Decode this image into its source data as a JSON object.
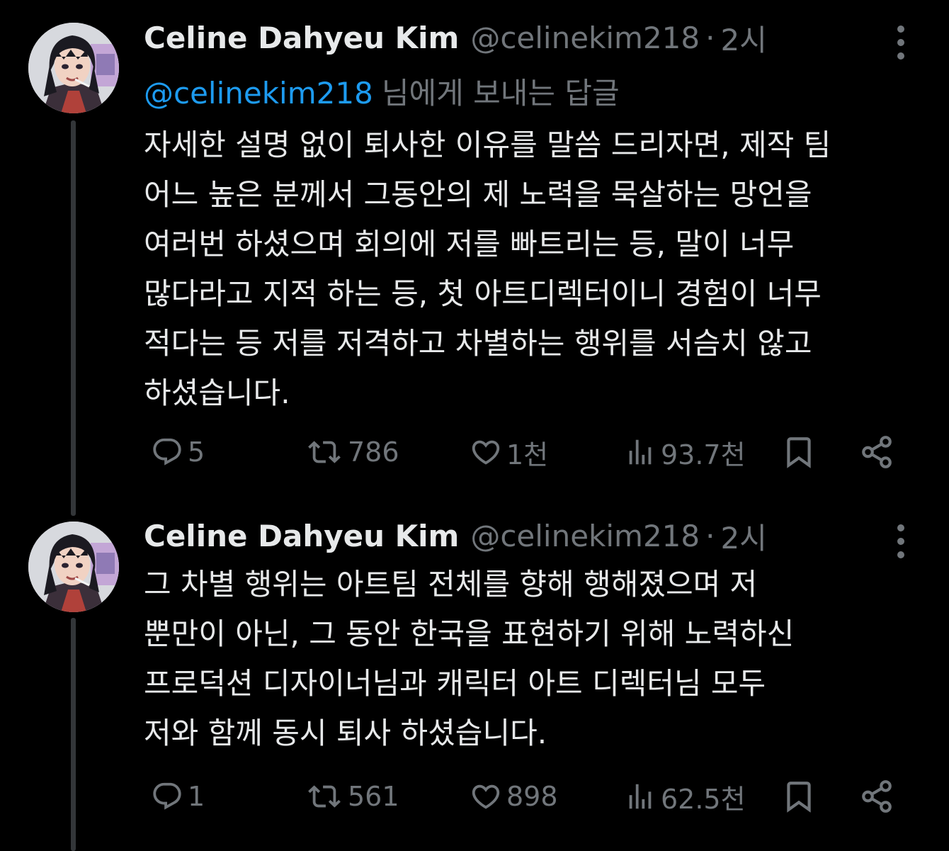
{
  "tweets": [
    {
      "author_name": "Celine Dahyeu Kim",
      "author_handle": "@celinekim218",
      "separator": "·",
      "time": "2시",
      "replying_to_handle": "@celinekim218",
      "replying_to_suffix": "님에게 보내는 답글",
      "text_lines": [
        "자세한 설명 없이 퇴사한 이유를 말씀 드리자면, 제작 팀",
        "어느 높은 분께서 그동안의 제 노력을 묵살하는 망언을",
        "여러번 하셨으며 회의에 저를 빠트리는 등, 말이 너무",
        "많다라고 지적 하는 등, 첫 아트디렉터이니 경험이 너무",
        "적다는 등 저를 저격하고 차별하는 행위를 서슴치 않고",
        "하셨습니다."
      ],
      "stats": {
        "replies": "5",
        "retweets": "786",
        "likes": "1천",
        "views": "93.7천"
      }
    },
    {
      "author_name": "Celine Dahyeu Kim",
      "author_handle": "@celinekim218",
      "separator": "·",
      "time": "2시",
      "text_lines": [
        "그 차별 행위는 아트팀 전체를 향해 행해졌으며 저",
        "뿐만이 아닌, 그 동안 한국을 표현하기 위해 노력하신",
        "프로덕션 디자이너님과 캐릭터 아트 디렉터님 모두",
        "저와 함께 동시 퇴사 하셨습니다."
      ],
      "stats": {
        "replies": "1",
        "retweets": "561",
        "likes": "898",
        "views": "62.5천"
      }
    }
  ],
  "icons": {
    "reply": "reply-icon",
    "retweet": "retweet-icon",
    "like": "heart-icon",
    "views": "views-icon",
    "bookmark": "bookmark-icon",
    "share": "share-icon",
    "more": "more-icon",
    "avatar": "avatar-illustration"
  },
  "colors": {
    "background": "#000000",
    "text_primary": "#e7e9ea",
    "text_secondary": "#71767b",
    "mention": "#1d9bf0",
    "thread_line": "#333639"
  }
}
